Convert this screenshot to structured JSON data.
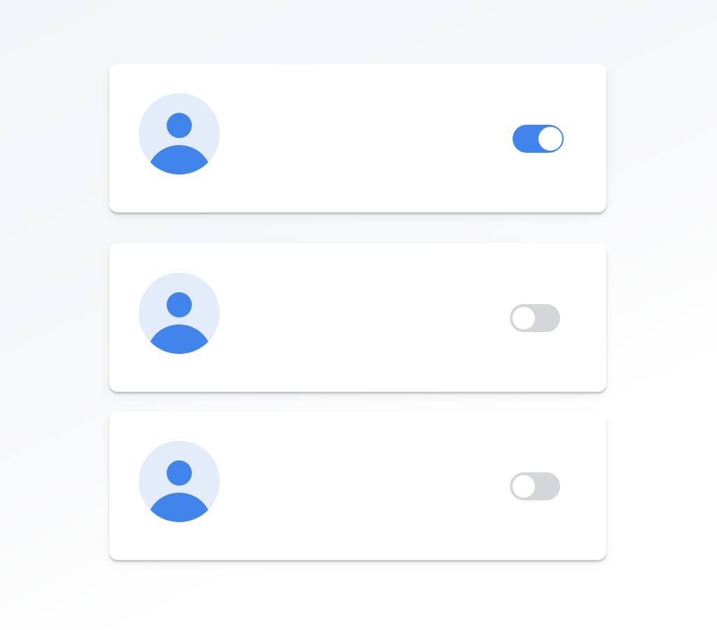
{
  "colors": {
    "accent": "#4184ec",
    "avatar_bg": "#e3ecf9",
    "toggle_off": "#d4d6d9",
    "card_bg": "#ffffff"
  },
  "list": {
    "items": [
      {
        "avatar_icon": "person-icon",
        "toggle_on": true
      },
      {
        "avatar_icon": "person-icon",
        "toggle_on": false
      },
      {
        "avatar_icon": "person-icon",
        "toggle_on": false
      }
    ]
  }
}
